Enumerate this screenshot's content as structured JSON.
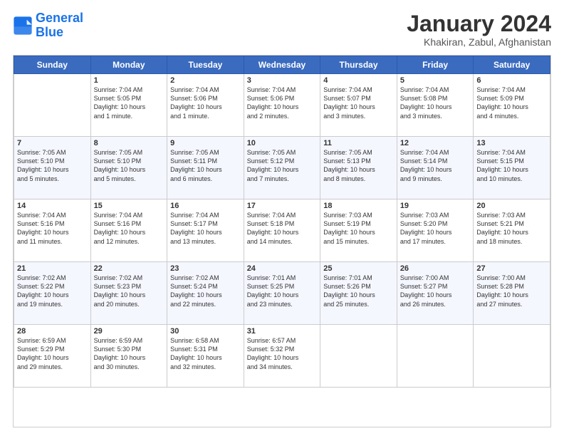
{
  "header": {
    "logo_line1": "General",
    "logo_line2": "Blue",
    "month": "January 2024",
    "location": "Khakiran, Zabul, Afghanistan"
  },
  "weekdays": [
    "Sunday",
    "Monday",
    "Tuesday",
    "Wednesday",
    "Thursday",
    "Friday",
    "Saturday"
  ],
  "weeks": [
    [
      {
        "day": "",
        "info": ""
      },
      {
        "day": "1",
        "info": "Sunrise: 7:04 AM\nSunset: 5:05 PM\nDaylight: 10 hours\nand 1 minute."
      },
      {
        "day": "2",
        "info": "Sunrise: 7:04 AM\nSunset: 5:06 PM\nDaylight: 10 hours\nand 1 minute."
      },
      {
        "day": "3",
        "info": "Sunrise: 7:04 AM\nSunset: 5:06 PM\nDaylight: 10 hours\nand 2 minutes."
      },
      {
        "day": "4",
        "info": "Sunrise: 7:04 AM\nSunset: 5:07 PM\nDaylight: 10 hours\nand 3 minutes."
      },
      {
        "day": "5",
        "info": "Sunrise: 7:04 AM\nSunset: 5:08 PM\nDaylight: 10 hours\nand 3 minutes."
      },
      {
        "day": "6",
        "info": "Sunrise: 7:04 AM\nSunset: 5:09 PM\nDaylight: 10 hours\nand 4 minutes."
      }
    ],
    [
      {
        "day": "7",
        "info": "Sunrise: 7:05 AM\nSunset: 5:10 PM\nDaylight: 10 hours\nand 5 minutes."
      },
      {
        "day": "8",
        "info": "Sunrise: 7:05 AM\nSunset: 5:10 PM\nDaylight: 10 hours\nand 5 minutes."
      },
      {
        "day": "9",
        "info": "Sunrise: 7:05 AM\nSunset: 5:11 PM\nDaylight: 10 hours\nand 6 minutes."
      },
      {
        "day": "10",
        "info": "Sunrise: 7:05 AM\nSunset: 5:12 PM\nDaylight: 10 hours\nand 7 minutes."
      },
      {
        "day": "11",
        "info": "Sunrise: 7:05 AM\nSunset: 5:13 PM\nDaylight: 10 hours\nand 8 minutes."
      },
      {
        "day": "12",
        "info": "Sunrise: 7:04 AM\nSunset: 5:14 PM\nDaylight: 10 hours\nand 9 minutes."
      },
      {
        "day": "13",
        "info": "Sunrise: 7:04 AM\nSunset: 5:15 PM\nDaylight: 10 hours\nand 10 minutes."
      }
    ],
    [
      {
        "day": "14",
        "info": "Sunrise: 7:04 AM\nSunset: 5:16 PM\nDaylight: 10 hours\nand 11 minutes."
      },
      {
        "day": "15",
        "info": "Sunrise: 7:04 AM\nSunset: 5:16 PM\nDaylight: 10 hours\nand 12 minutes."
      },
      {
        "day": "16",
        "info": "Sunrise: 7:04 AM\nSunset: 5:17 PM\nDaylight: 10 hours\nand 13 minutes."
      },
      {
        "day": "17",
        "info": "Sunrise: 7:04 AM\nSunset: 5:18 PM\nDaylight: 10 hours\nand 14 minutes."
      },
      {
        "day": "18",
        "info": "Sunrise: 7:03 AM\nSunset: 5:19 PM\nDaylight: 10 hours\nand 15 minutes."
      },
      {
        "day": "19",
        "info": "Sunrise: 7:03 AM\nSunset: 5:20 PM\nDaylight: 10 hours\nand 17 minutes."
      },
      {
        "day": "20",
        "info": "Sunrise: 7:03 AM\nSunset: 5:21 PM\nDaylight: 10 hours\nand 18 minutes."
      }
    ],
    [
      {
        "day": "21",
        "info": "Sunrise: 7:02 AM\nSunset: 5:22 PM\nDaylight: 10 hours\nand 19 minutes."
      },
      {
        "day": "22",
        "info": "Sunrise: 7:02 AM\nSunset: 5:23 PM\nDaylight: 10 hours\nand 20 minutes."
      },
      {
        "day": "23",
        "info": "Sunrise: 7:02 AM\nSunset: 5:24 PM\nDaylight: 10 hours\nand 22 minutes."
      },
      {
        "day": "24",
        "info": "Sunrise: 7:01 AM\nSunset: 5:25 PM\nDaylight: 10 hours\nand 23 minutes."
      },
      {
        "day": "25",
        "info": "Sunrise: 7:01 AM\nSunset: 5:26 PM\nDaylight: 10 hours\nand 25 minutes."
      },
      {
        "day": "26",
        "info": "Sunrise: 7:00 AM\nSunset: 5:27 PM\nDaylight: 10 hours\nand 26 minutes."
      },
      {
        "day": "27",
        "info": "Sunrise: 7:00 AM\nSunset: 5:28 PM\nDaylight: 10 hours\nand 27 minutes."
      }
    ],
    [
      {
        "day": "28",
        "info": "Sunrise: 6:59 AM\nSunset: 5:29 PM\nDaylight: 10 hours\nand 29 minutes."
      },
      {
        "day": "29",
        "info": "Sunrise: 6:59 AM\nSunset: 5:30 PM\nDaylight: 10 hours\nand 30 minutes."
      },
      {
        "day": "30",
        "info": "Sunrise: 6:58 AM\nSunset: 5:31 PM\nDaylight: 10 hours\nand 32 minutes."
      },
      {
        "day": "31",
        "info": "Sunrise: 6:57 AM\nSunset: 5:32 PM\nDaylight: 10 hours\nand 34 minutes."
      },
      {
        "day": "",
        "info": ""
      },
      {
        "day": "",
        "info": ""
      },
      {
        "day": "",
        "info": ""
      }
    ]
  ]
}
